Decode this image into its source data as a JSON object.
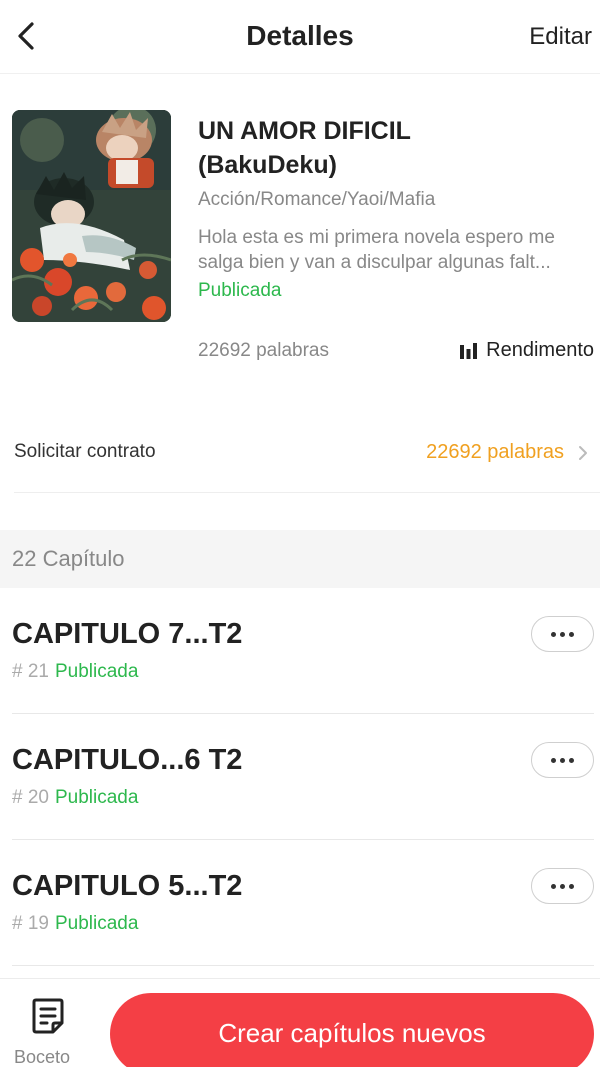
{
  "header": {
    "title": "Detalles",
    "edit_label": "Editar"
  },
  "book": {
    "title_line1": "UN AMOR DIFICIL",
    "title_line2": "(BakuDeku)",
    "genres": "Acción/Romance/Yaoi/Mafia",
    "description_line1": "Hola esta es mi primera novela espero me",
    "description_line2": "salga bien y van a disculpar algunas falt...",
    "status": "Publicada",
    "word_count": "22692 palabras",
    "performance_label": "Rendimento"
  },
  "contract": {
    "label": "Solicitar contrato",
    "value": "22692 palabras"
  },
  "chapters_section": {
    "label": "22 Capítulo",
    "items": [
      {
        "title": "CAPITULO 7...T2",
        "number": "# 21",
        "status": "Publicada"
      },
      {
        "title": "CAPITULO...6 T2",
        "number": "# 20",
        "status": "Publicada"
      },
      {
        "title": "CAPITULO 5...T2",
        "number": "# 19",
        "status": "Publicada"
      }
    ]
  },
  "bottom_bar": {
    "draft_label": "Boceto",
    "create_label": "Crear capítulos nuevos"
  },
  "colors": {
    "published_green": "#2db84d",
    "contract_orange": "#f0a020",
    "create_button_red": "#f43f45"
  },
  "icons": {
    "back": "chevron-left-icon",
    "performance": "bar-chart-icon",
    "contract_chevron": "chevron-right-icon",
    "more": "more-dots-icon",
    "draft": "draft-document-icon"
  }
}
